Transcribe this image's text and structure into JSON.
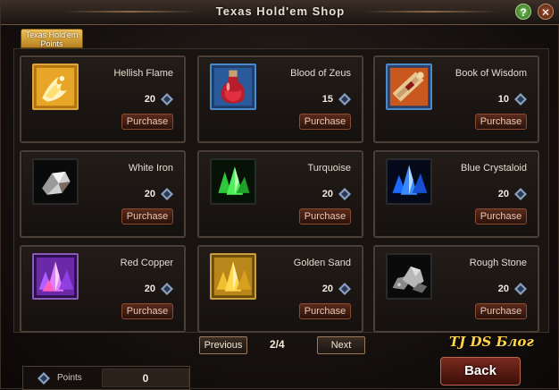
{
  "window": {
    "title": "Texas Hold'em Shop",
    "help_label": "?",
    "close_label": "✕"
  },
  "tab": {
    "label": "Texas Hold'em Points"
  },
  "items": [
    {
      "name": "Hellish Flame",
      "price": "20",
      "purchase_label": "Purchase",
      "icon": "fire-icon"
    },
    {
      "name": "Blood of Zeus",
      "price": "15",
      "purchase_label": "Purchase",
      "icon": "potion-icon"
    },
    {
      "name": "Book of Wisdom",
      "price": "10",
      "purchase_label": "Purchase",
      "icon": "scroll-icon"
    },
    {
      "name": "White Iron",
      "price": "20",
      "purchase_label": "Purchase",
      "icon": "ore-icon"
    },
    {
      "name": "Turquoise",
      "price": "20",
      "purchase_label": "Purchase",
      "icon": "green-crystal-icon"
    },
    {
      "name": "Blue Crystaloid",
      "price": "20",
      "purchase_label": "Purchase",
      "icon": "blue-crystal-icon"
    },
    {
      "name": "Red Copper",
      "price": "20",
      "purchase_label": "Purchase",
      "icon": "purple-crystal-icon"
    },
    {
      "name": "Golden Sand",
      "price": "20",
      "purchase_label": "Purchase",
      "icon": "gold-crystal-icon"
    },
    {
      "name": "Rough Stone",
      "price": "20",
      "purchase_label": "Purchase",
      "icon": "stone-icon"
    }
  ],
  "pager": {
    "previous_label": "Previous",
    "next_label": "Next",
    "page": "2/4"
  },
  "points": {
    "label": "Points",
    "value": "0"
  },
  "watermark": "TJ DS Блог",
  "back_label": "Back",
  "colors": {
    "tab": "#d9a23a",
    "purchase_button": "#4a2016",
    "back_button": "#6a2218"
  }
}
